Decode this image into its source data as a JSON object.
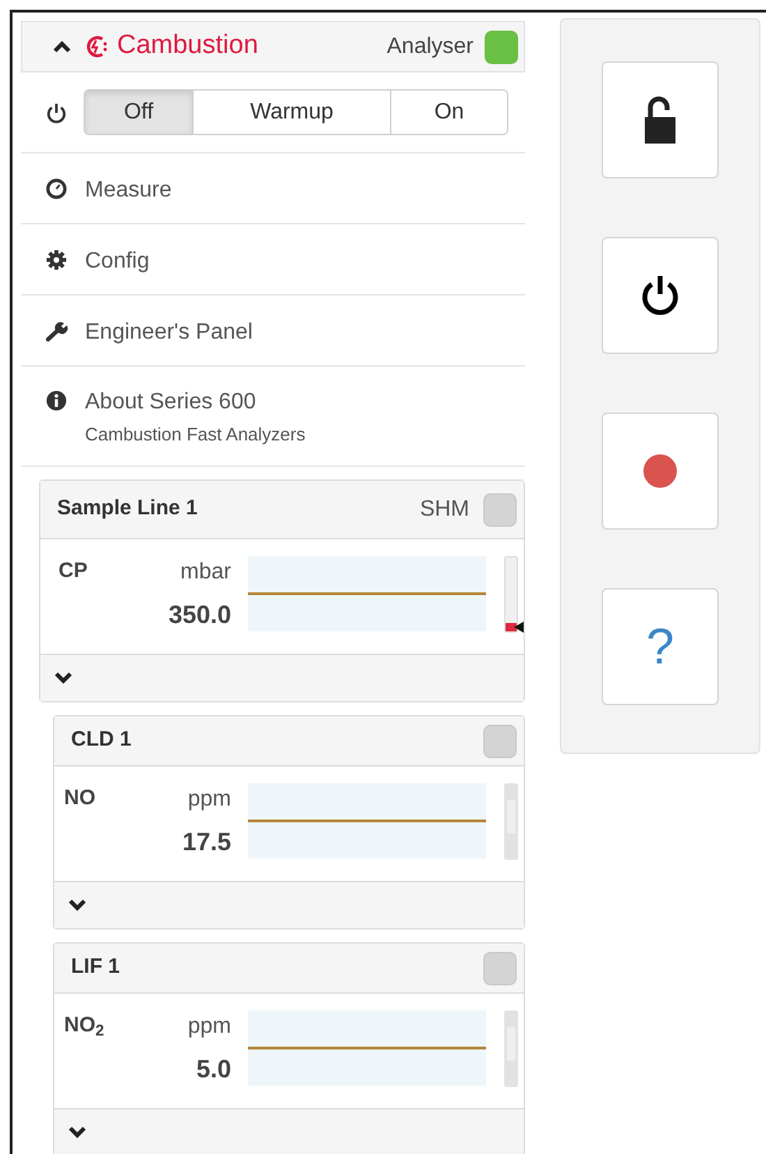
{
  "header": {
    "brand": "Cambustion",
    "label": "Analyser",
    "status_on": true
  },
  "mode": {
    "options": [
      {
        "label": "Off",
        "selected": true
      },
      {
        "label": "Warmup",
        "selected": false
      },
      {
        "label": "On",
        "selected": false
      }
    ]
  },
  "menu": [
    {
      "kind": "measure",
      "label": "Measure"
    },
    {
      "kind": "config",
      "label": "Config"
    },
    {
      "kind": "engineer",
      "label": "Engineer's Panel"
    },
    {
      "kind": "about",
      "label": "About Series 600",
      "sublabel": "Cambustion Fast Analyzers"
    }
  ],
  "panels": [
    {
      "title": "Sample Line 1",
      "badge": "SHM",
      "status_on": false,
      "channels": [
        {
          "name": "CP",
          "unit": "mbar",
          "value": "350.0",
          "level": 0.12
        }
      ],
      "children": [
        {
          "title": "CLD 1",
          "status_on": false,
          "channels": [
            {
              "name": "NO",
              "unit": "ppm",
              "value": "17.5"
            }
          ]
        },
        {
          "title": "LIF 1",
          "status_on": false,
          "channels": [
            {
              "name": "NO$_{2}$",
              "unit": "ppm",
              "value": "5.0"
            }
          ]
        }
      ]
    }
  ],
  "toolbar": [
    {
      "kind": "unlock"
    },
    {
      "kind": "power"
    },
    {
      "kind": "record"
    },
    {
      "kind": "help",
      "glyph": "?"
    }
  ]
}
